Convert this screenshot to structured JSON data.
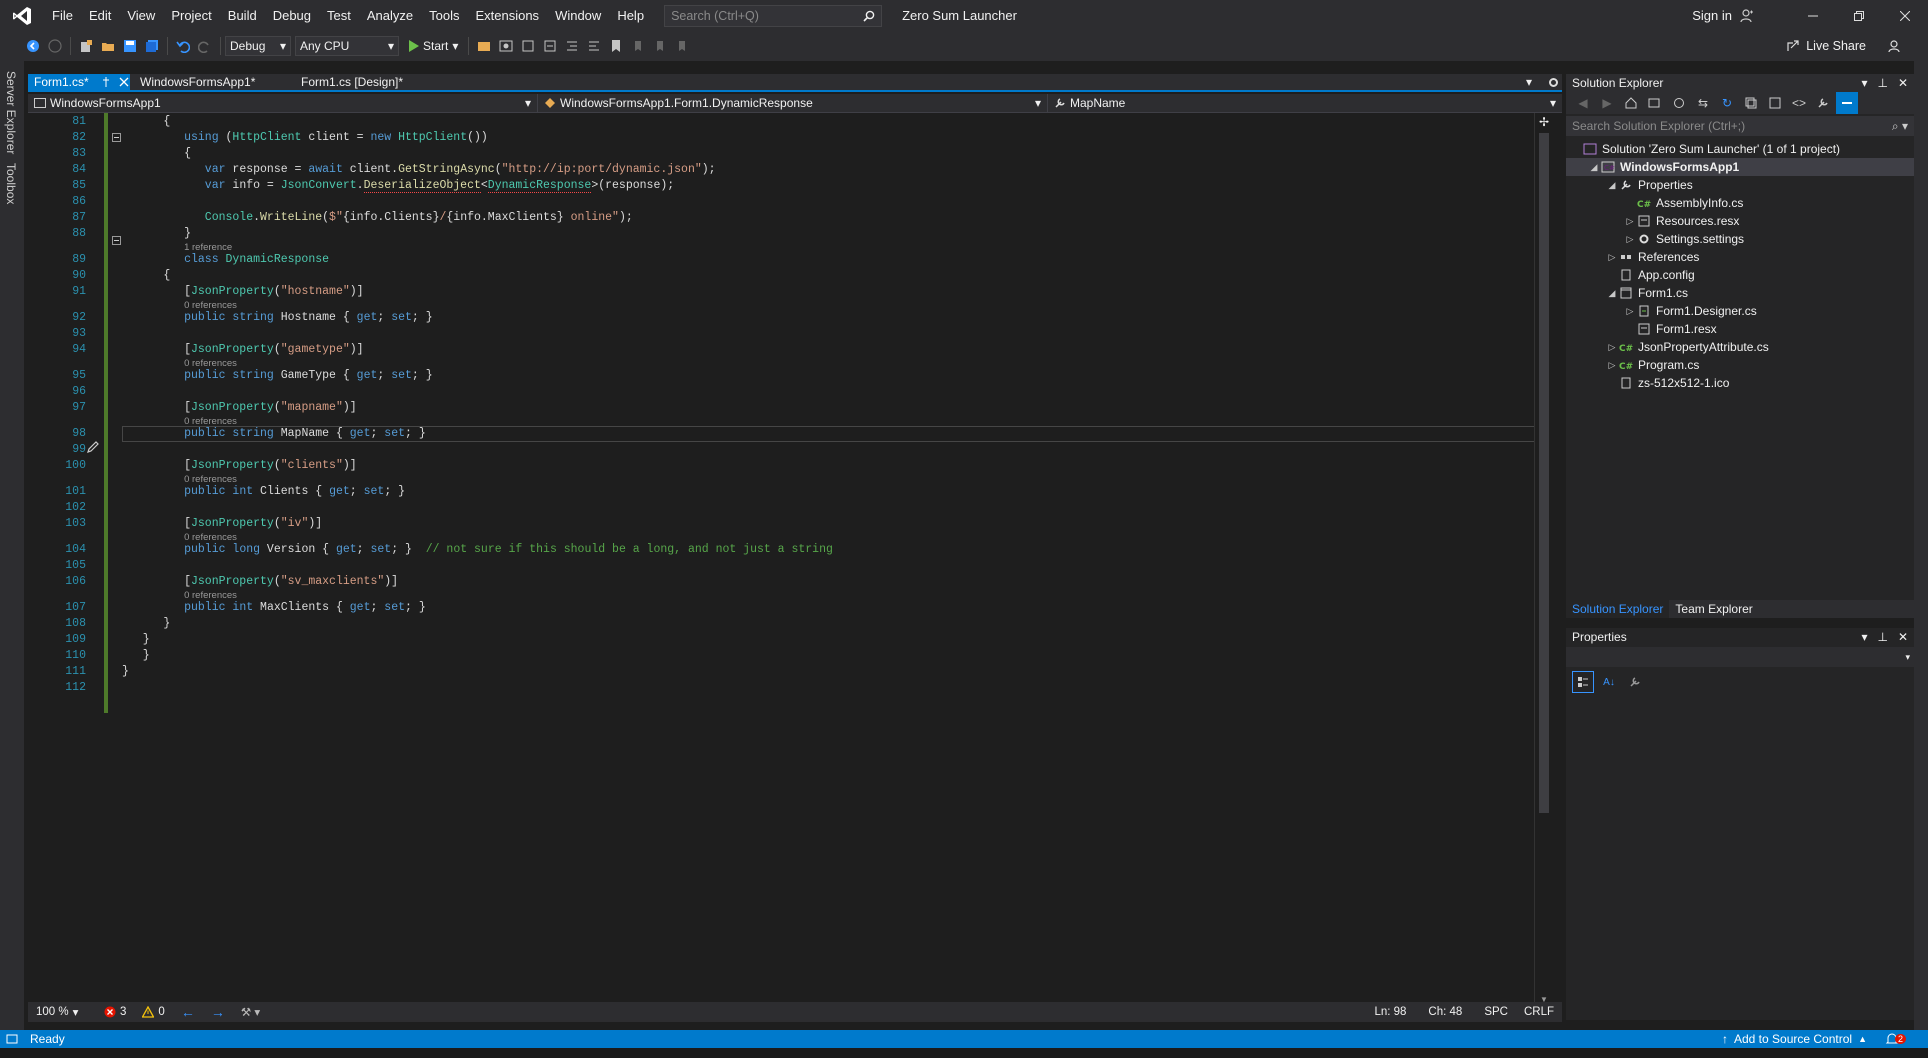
{
  "menu": {
    "items": [
      "File",
      "Edit",
      "View",
      "Project",
      "Build",
      "Debug",
      "Test",
      "Analyze",
      "Tools",
      "Extensions",
      "Window",
      "Help"
    ],
    "search_placeholder": "Search (Ctrl+Q)",
    "window_title": "Zero Sum Launcher",
    "sign_in": "Sign in"
  },
  "toolbar": {
    "config": "Debug",
    "platform": "Any CPU",
    "start_label": "Start",
    "live_share": "Live Share"
  },
  "left_strip": {
    "server_explorer": "Server Explorer",
    "toolbox": "Toolbox"
  },
  "tabs": [
    {
      "label": "Form1.cs*",
      "active": true
    },
    {
      "label": "WindowsFormsApp1*",
      "active": false
    },
    {
      "label": "Form1.cs [Design]*",
      "active": false
    }
  ],
  "navbar": {
    "project": "WindowsFormsApp1",
    "type": "WindowsFormsApp1.Form1.DynamicResponse",
    "member": "MapName"
  },
  "code": {
    "line_numbers": [
      "81",
      "82",
      "83",
      "84",
      "85",
      "86",
      "87",
      "88",
      "89",
      "90",
      "91",
      "92",
      "93",
      "94",
      "95",
      "96",
      "97",
      "98",
      "99",
      "100",
      "101",
      "102",
      "103",
      "104",
      "105",
      "106",
      "107",
      "108",
      "109",
      "110",
      "111",
      "112"
    ],
    "lens": {
      "one_ref": "1 reference",
      "zero_refs": "0 references"
    },
    "strings": {
      "url": "\"http://ip:port/dynamic.json\"",
      "hostname": "\"hostname\"",
      "gametype": "\"gametype\"",
      "mapname": "\"mapname\"",
      "clients": "\"clients\"",
      "iv": "\"iv\"",
      "maxclients": "\"sv_maxclients\"",
      "interp_a": "$\"",
      "interp_b": "/",
      "interp_c": " online\""
    },
    "comment": "// not sure if this should be a long, and not just a string"
  },
  "editor_status": {
    "zoom": "100 %",
    "errors": "3",
    "warnings": "0",
    "line": "Ln: 98",
    "col": "Ch: 48",
    "spc": "SPC",
    "eol": "CRLF"
  },
  "solution_explorer": {
    "title": "Solution Explorer",
    "search_placeholder": "Search Solution Explorer (Ctrl+;)",
    "items": [
      {
        "label": "Solution 'Zero Sum Launcher' (1 of 1 project)",
        "icon": "solution-icon"
      },
      {
        "label": "WindowsFormsApp1",
        "icon": "csharp-project-icon"
      },
      {
        "label": "Properties",
        "icon": "wrench-icon"
      },
      {
        "label": "AssemblyInfo.cs",
        "icon": "csharp-file-icon"
      },
      {
        "label": "Resources.resx",
        "icon": "resx-icon"
      },
      {
        "label": "Settings.settings",
        "icon": "gear-icon"
      },
      {
        "label": "References",
        "icon": "references-icon"
      },
      {
        "label": "App.config",
        "icon": "config-icon"
      },
      {
        "label": "Form1.cs",
        "icon": "form-icon"
      },
      {
        "label": "Form1.Designer.cs",
        "icon": "designer-file-icon"
      },
      {
        "label": "Form1.resx",
        "icon": "resx-icon"
      },
      {
        "label": "JsonPropertyAttribute.cs",
        "icon": "csharp-file-icon"
      },
      {
        "label": "Program.cs",
        "icon": "csharp-file-icon"
      },
      {
        "label": "zs-512x512-1.ico",
        "icon": "ico-file-icon"
      }
    ],
    "tabs": [
      "Solution Explorer",
      "Team Explorer"
    ]
  },
  "properties": {
    "title": "Properties"
  },
  "statusbar": {
    "ready": "Ready",
    "source_control": "Add to Source Control",
    "notifications": "2"
  }
}
